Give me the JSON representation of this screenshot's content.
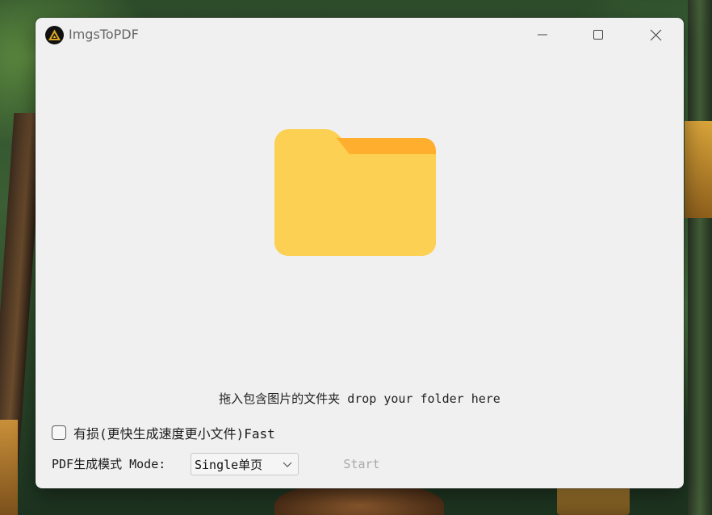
{
  "window": {
    "title": "ImgsToPDF"
  },
  "drop_zone": {
    "icon": "folder-icon",
    "instruction": "拖入包含图片的文件夹 drop your folder here"
  },
  "options": {
    "lossy_checkbox_label": "有损(更快生成速度更小文件)Fast",
    "lossy_checked": false,
    "mode_label": "PDF生成模式 Mode:",
    "mode_selected": "Single单页",
    "start_label": "Start",
    "start_enabled": false
  },
  "colors": {
    "folder_body": "#FCD053",
    "folder_tab": "#FFAE2E",
    "window_bg": "#F0F0F0"
  }
}
